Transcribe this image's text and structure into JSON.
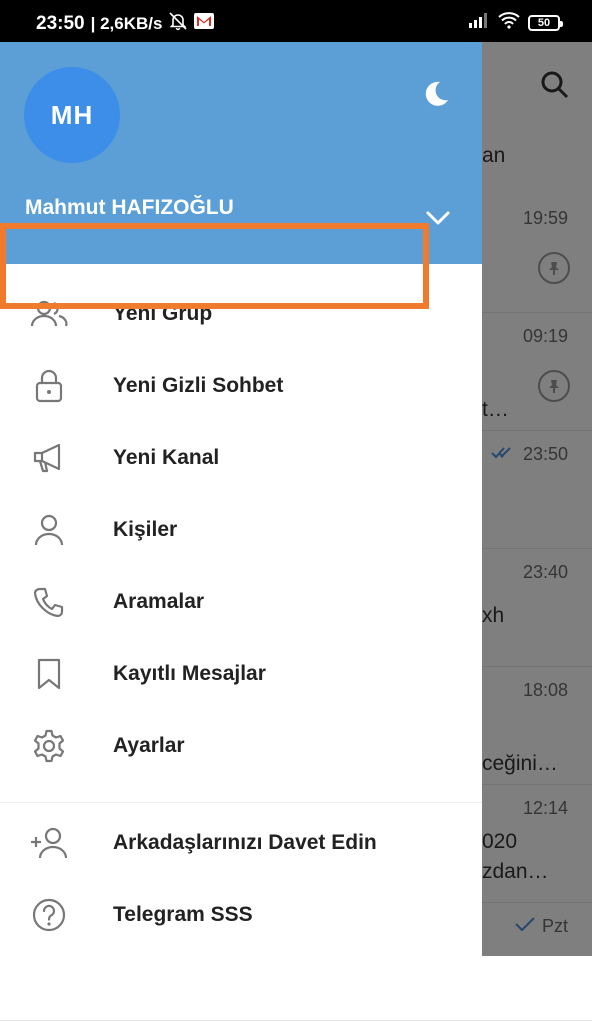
{
  "status_bar": {
    "time": "23:50",
    "speed": "| 2,6KB/s",
    "battery": "50"
  },
  "background": {
    "tab_partial": "an",
    "chats": [
      {
        "time": "19:59",
        "snippet": "",
        "snippet2": "",
        "pinned": true,
        "read_ticks": false
      },
      {
        "time": "09:19",
        "snippet": "",
        "snippet2": "t…",
        "pinned": true,
        "read_ticks": false
      },
      {
        "time": "23:50",
        "snippet": "",
        "snippet2": "",
        "pinned": false,
        "read_ticks": true
      },
      {
        "time": "23:40",
        "snippet": "xh",
        "snippet2": "",
        "pinned": false,
        "read_ticks": false
      },
      {
        "time": "18:08",
        "snippet": "",
        "snippet2": "ceğini…",
        "pinned": false,
        "read_ticks": false
      },
      {
        "time": "12:14",
        "snippet": "020",
        "snippet2": "zdan…",
        "pinned": false,
        "read_ticks": false
      },
      {
        "time": "Pzt",
        "snippet": "",
        "snippet2": "",
        "pinned": false,
        "read_ticks": true
      }
    ]
  },
  "drawer": {
    "avatar_initials": "MH",
    "user_name": "Mahmut HAFIZOĞLU",
    "header_color": "#5b9fd6",
    "avatar_color": "#3d8ee8",
    "menu": [
      {
        "label": "Yeni Grup",
        "icon": "group-icon"
      },
      {
        "label": "Yeni Gizli Sohbet",
        "icon": "lock-icon"
      },
      {
        "label": "Yeni Kanal",
        "icon": "megaphone-icon"
      },
      {
        "label": "Kişiler",
        "icon": "person-icon"
      },
      {
        "label": "Aramalar",
        "icon": "phone-icon"
      },
      {
        "label": "Kayıtlı Mesajlar",
        "icon": "bookmark-icon"
      },
      {
        "label": "Ayarlar",
        "icon": "gear-icon"
      }
    ],
    "menu_extra": [
      {
        "label": "Arkadaşlarınızı Davet Edin",
        "icon": "add-person-icon"
      },
      {
        "label": "Telegram SSS",
        "icon": "help-icon"
      }
    ],
    "highlight_color": "#f07b2c"
  }
}
